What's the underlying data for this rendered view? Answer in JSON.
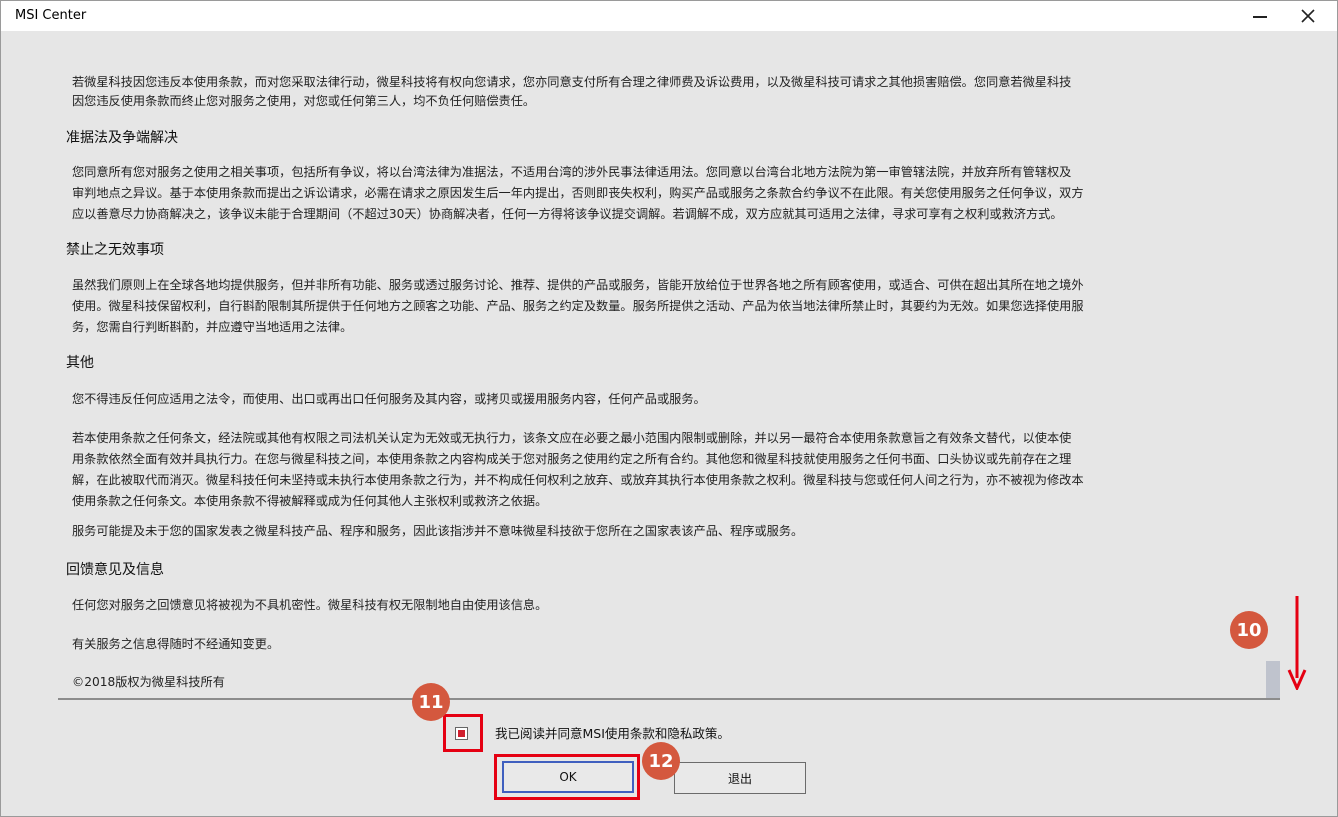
{
  "window": {
    "title": "MSI Center"
  },
  "terms": {
    "partial_top_line": "若微星科技因您违反本使用条款，而对您采取法律行动，微星科技将有权向您请求，您亦同意支付所有合理之律师费及诉讼费用，以及微星科技可请求之其他损害赔偿。您同意若微星科技",
    "partial_top_line2": "因您违反使用条款而终止您对服务之使用，对您或任何第三人，均不负任何赔偿责任。",
    "s1_heading": "准据法及争端解决",
    "s1_l1": "您同意所有您对服务之使用之相关事项，包括所有争议，将以台湾法律为准据法，不适用台湾的涉外民事法律适用法。您同意以台湾台北地方法院为第一审管辖法院，并放弃所有管辖权及",
    "s1_l2": "审判地点之异议。基于本使用条款而提出之诉讼请求，必需在请求之原因发生后一年内提出，否则即丧失权利，购买产品或服务之条款合约争议不在此限。有关您使用服务之任何争议，双方",
    "s1_l3": "应以善意尽力协商解决之，该争议未能于合理期间（不超过30天）协商解决者，任何一方得将该争议提交调解。若调解不成，双方应就其可适用之法律，寻求可享有之权利或救济方式。",
    "s2_heading": "禁止之无效事项",
    "s2_l1": "虽然我们原则上在全球各地均提供服务，但并非所有功能、服务或透过服务讨论、推荐、提供的产品或服务，皆能开放给位于世界各地之所有顾客使用，或适合、可供在超出其所在地之境外",
    "s2_l2": "使用。微星科技保留权利，自行斟酌限制其所提供于任何地方之顾客之功能、产品、服务之约定及数量。服务所提供之活动、产品为依当地法律所禁止时，其要约为无效。如果您选择使用服",
    "s2_l3": "务，您需自行判断斟酌，并应遵守当地适用之法律。",
    "s3_heading": "其他",
    "s3_p1": "您不得违反任何应适用之法令，而使用、出口或再出口任何服务及其内容，或拷贝或援用服务内容，任何产品或服务。",
    "s3_p2_l1": "若本使用条款之任何条文，经法院或其他有权限之司法机关认定为无效或无执行力，该条文应在必要之最小范围内限制或删除，并以另一最符合本使用条款意旨之有效条文替代，以使本使",
    "s3_p2_l2": "用条款依然全面有效并具执行力。在您与微星科技之间，本使用条款之内容构成关于您对服务之使用约定之所有合约。其他您和微星科技就使用服务之任何书面、口头协议或先前存在之理",
    "s3_p2_l3": "解，在此被取代而消灭。微星科技任何未坚持或未执行本使用条款之行为，并不构成任何权利之放弃、或放弃其执行本使用条款之权利。微星科技与您或任何人间之行为，亦不被视为修改本",
    "s3_p2_l4": "使用条款之任何条文。本使用条款不得被解释或成为任何其他人主张权利或救济之依据。",
    "s3_p3": "服务可能提及未于您的国家发表之微星科技产品、程序和服务，因此该指涉并不意味微星科技欲于您所在之国家表该产品、程序或服务。",
    "s4_heading": "回馈意见及信息",
    "s4_p1": "任何您对服务之回馈意见将被视为不具机密性。微星科技有权无限制地自由使用该信息。",
    "s4_p2": "有关服务之信息得随时不经通知变更。",
    "copyright": "©2018版权为微星科技所有"
  },
  "agreement": {
    "checkbox_label": "我已阅读并同意MSI使用条款和隐私政策。",
    "checked": true
  },
  "buttons": {
    "ok": "OK",
    "exit": "退出"
  },
  "annotations": {
    "badge_10": "10",
    "badge_11": "11",
    "badge_12": "12",
    "color": "#d4583e",
    "highlight_color": "#e50012"
  },
  "colors": {
    "checkbox_mark": "#d01f2e",
    "ok_focus": "#3f5fbf"
  }
}
